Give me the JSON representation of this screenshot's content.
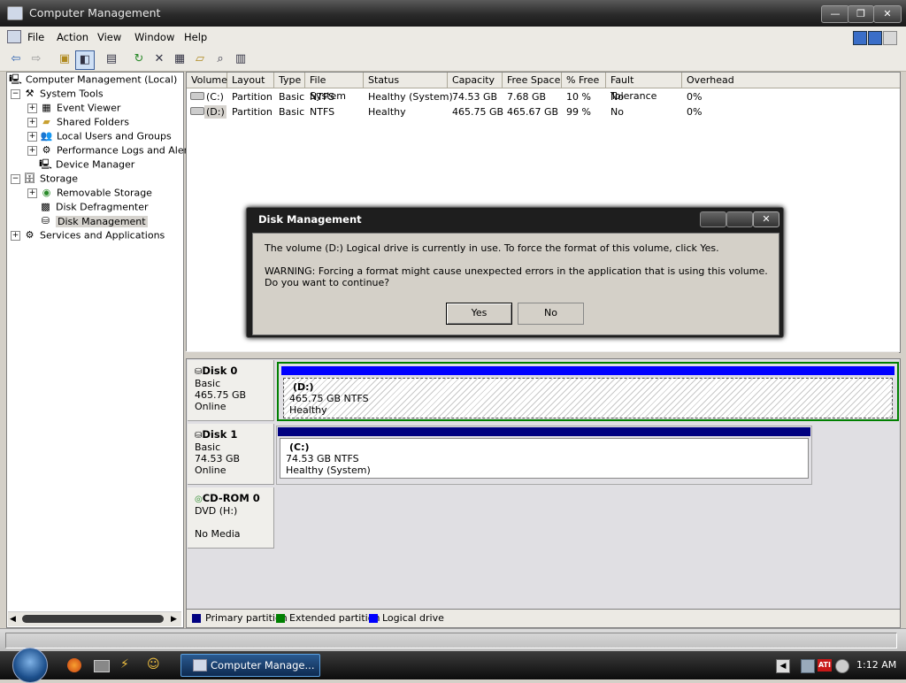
{
  "window": {
    "title": "Computer Management",
    "min_btn": "—",
    "max_btn": "❐",
    "close_btn": "✕"
  },
  "menu": [
    "File",
    "Action",
    "View",
    "Window",
    "Help"
  ],
  "tree": {
    "root": "Computer Management (Local)",
    "system_tools": "System Tools",
    "event_viewer": "Event Viewer",
    "shared_folders": "Shared Folders",
    "local_users": "Local Users and Groups",
    "perf_logs": "Performance Logs and Alerts",
    "device_manager": "Device Manager",
    "storage": "Storage",
    "removable_storage": "Removable Storage",
    "disk_defrag": "Disk Defragmenter",
    "disk_mgmt": "Disk Management",
    "services": "Services and Applications"
  },
  "volumes": {
    "columns": [
      "Volume",
      "Layout",
      "Type",
      "File System",
      "Status",
      "Capacity",
      "Free Space",
      "% Free",
      "Fault Tolerance",
      "Overhead"
    ],
    "rows": [
      [
        "(C:)",
        "Partition",
        "Basic",
        "NTFS",
        "Healthy (System)",
        "74.53 GB",
        "7.68 GB",
        "10 %",
        "No",
        "0%"
      ],
      [
        "(D:)",
        "Partition",
        "Basic",
        "NTFS",
        "Healthy",
        "465.75 GB",
        "465.67 GB",
        "99 %",
        "No",
        "0%"
      ]
    ]
  },
  "disks": {
    "disk0": {
      "name": "Disk 0",
      "type": "Basic",
      "size": "465.75 GB",
      "state": "Online",
      "part_name": "(D:)",
      "part_size": "465.75 GB NTFS",
      "part_status": "Healthy"
    },
    "disk1": {
      "name": "Disk 1",
      "type": "Basic",
      "size": "74.53 GB",
      "state": "Online",
      "part_name": "(C:)",
      "part_size": "74.53 GB NTFS",
      "part_status": "Healthy (System)"
    },
    "cdrom": {
      "name": "CD-ROM 0",
      "drive": "DVD (H:)",
      "media": "No Media"
    }
  },
  "legend": {
    "primary": "Primary partition",
    "extended": "Extended partition",
    "logical": "Logical drive",
    "primary_color": "#000080",
    "extended_color": "#008000",
    "logical_color": "#0000ff"
  },
  "dialog": {
    "title": "Disk Management",
    "message1": "The volume  (D:) Logical drive is currently in use. To force the format of this volume, click Yes.",
    "message2": "WARNING: Forcing a format might cause unexpected errors in the application that is using this volume. Do you want to continue?",
    "yes": "Yes",
    "no": "No"
  },
  "taskbar": {
    "task": "Computer Manage...",
    "clock": "1:12 AM",
    "ati": "ATI"
  }
}
